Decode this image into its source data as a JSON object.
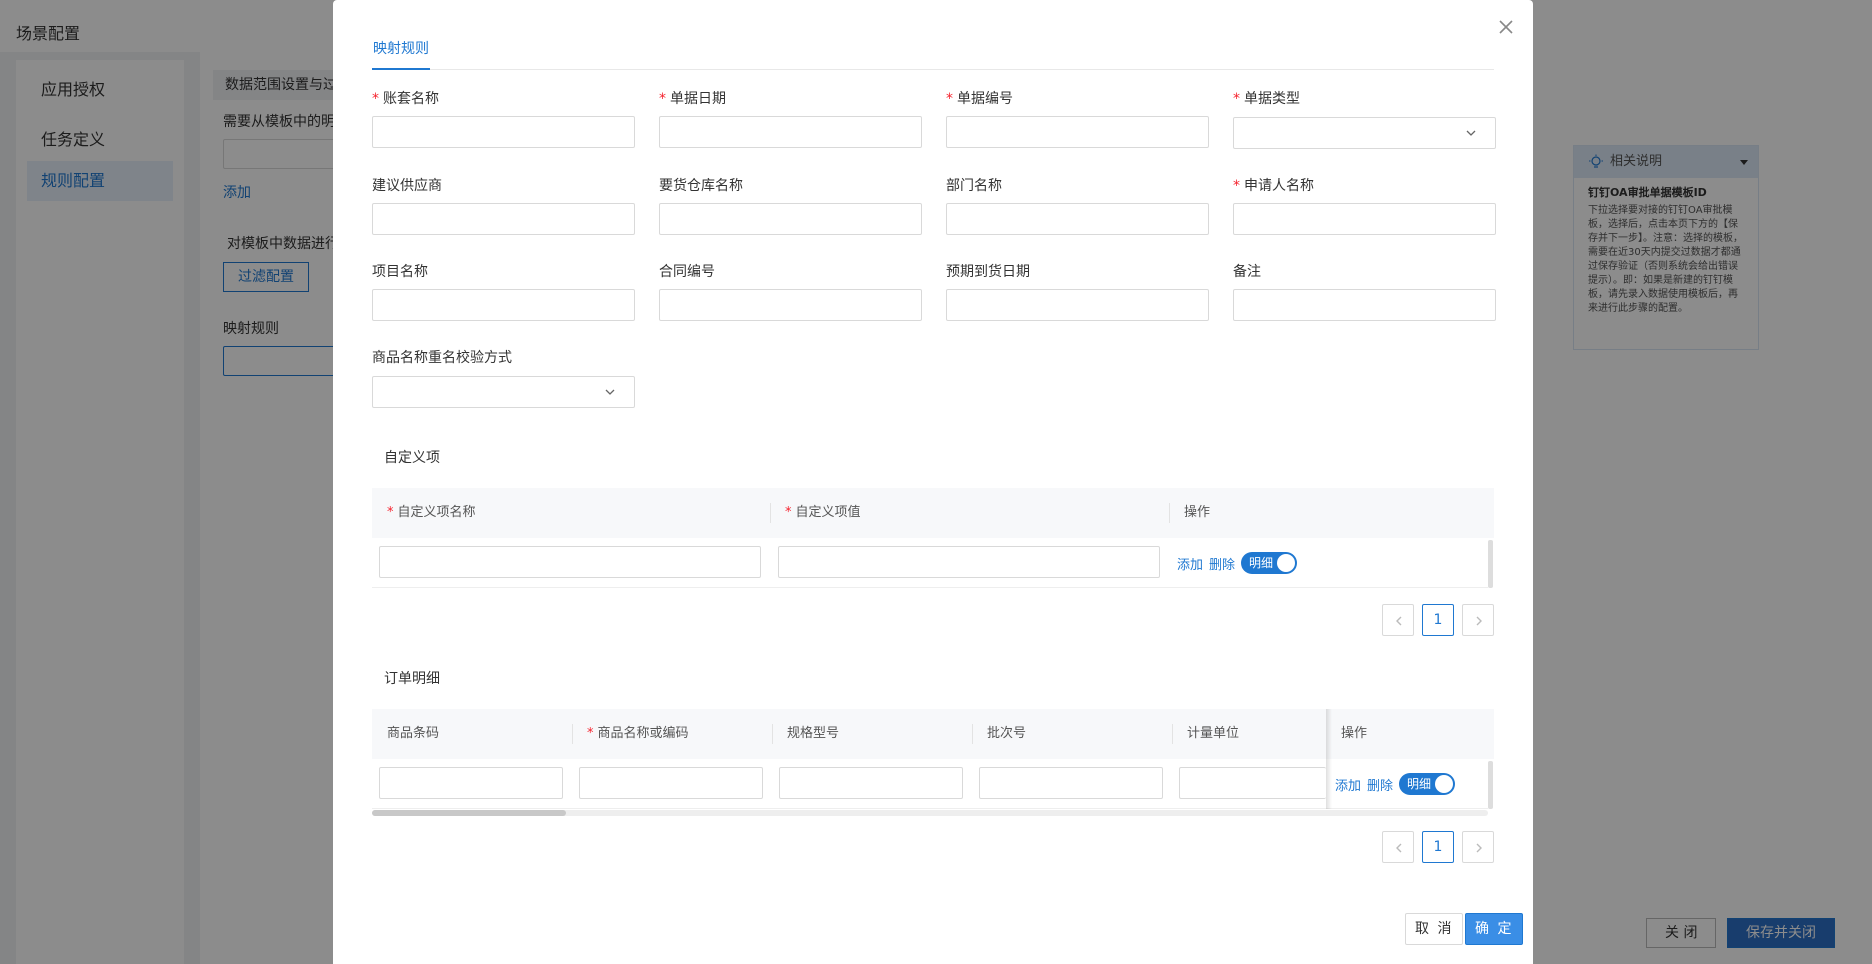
{
  "background": {
    "page_title": "场景配置",
    "sidebar": [
      {
        "label": "应用授权",
        "active": false
      },
      {
        "label": "任务定义",
        "active": false
      },
      {
        "label": "规则配置",
        "active": true
      }
    ],
    "section_title": "数据范围设置与过",
    "text_template_fields": "需要从模板中的明",
    "add_link": "添加",
    "text_filter": "对模板中数据进行",
    "filter_button": "过滤配置",
    "mapping_label": "映射规则",
    "help": {
      "header": "相关说明",
      "title": "钉钉OA审批单据模板ID",
      "body": "下拉选择要对接的钉钉OA审批模板，选择后，点击本页下方的【保存并下一步】。注意：选择的模板，需要在近30天内提交过数据才都通过保存验证（否则系统会给出错误提示）。即：如果是新建的钉钉模板，请先录入数据使用模板后，再来进行此步骤的配置。"
    },
    "close_button": "关 闭",
    "save_close_button": "保存并关闭"
  },
  "modal": {
    "tab": "映射规则",
    "fields": [
      {
        "label": "账套名称",
        "required": true,
        "type": "input",
        "value": ""
      },
      {
        "label": "单据日期",
        "required": true,
        "type": "input",
        "value": ""
      },
      {
        "label": "单据编号",
        "required": true,
        "type": "input",
        "value": ""
      },
      {
        "label": "单据类型",
        "required": true,
        "type": "select",
        "value": ""
      },
      {
        "label": "建议供应商",
        "required": false,
        "type": "input",
        "value": ""
      },
      {
        "label": "要货仓库名称",
        "required": false,
        "type": "input",
        "value": ""
      },
      {
        "label": "部门名称",
        "required": false,
        "type": "input",
        "value": ""
      },
      {
        "label": "申请人名称",
        "required": true,
        "type": "input",
        "value": ""
      },
      {
        "label": "项目名称",
        "required": false,
        "type": "input",
        "value": ""
      },
      {
        "label": "合同编号",
        "required": false,
        "type": "input",
        "value": ""
      },
      {
        "label": "预期到货日期",
        "required": false,
        "type": "input",
        "value": ""
      },
      {
        "label": "备注",
        "required": false,
        "type": "input",
        "value": ""
      },
      {
        "label": "商品名称重名校验方式",
        "required": false,
        "type": "select",
        "value": ""
      }
    ],
    "custom": {
      "title": "自定义项",
      "columns": [
        {
          "label": "自定义项名称",
          "required": true
        },
        {
          "label": "自定义项值",
          "required": true
        },
        {
          "label": "操作",
          "required": false
        }
      ],
      "row": {
        "add": "添加",
        "delete": "删除",
        "switch_label": "明细",
        "switch_on": true
      },
      "page": "1"
    },
    "order": {
      "title": "订单明细",
      "columns": [
        {
          "label": "商品条码",
          "required": false
        },
        {
          "label": "商品名称或编码",
          "required": true
        },
        {
          "label": "规格型号",
          "required": false
        },
        {
          "label": "批次号",
          "required": false
        },
        {
          "label": "计量单位",
          "required": false
        },
        {
          "label": "操作",
          "required": false
        }
      ],
      "row": {
        "add": "添加",
        "delete": "删除",
        "switch_label": "明细",
        "switch_on": true
      },
      "page": "1"
    },
    "cancel_button": "取 消",
    "ok_button": "确 定"
  }
}
